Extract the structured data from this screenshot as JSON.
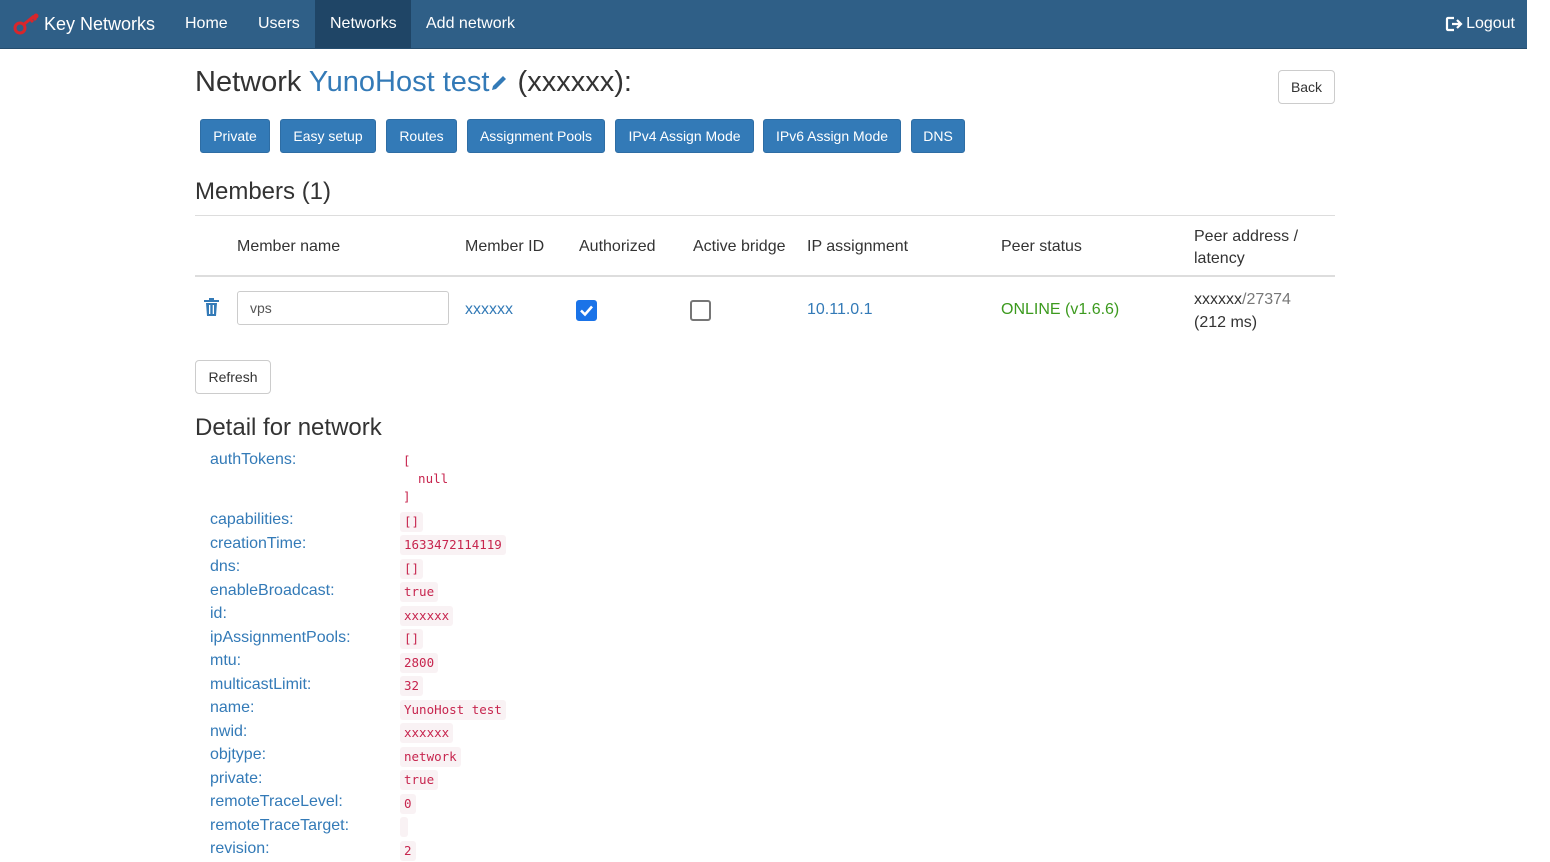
{
  "navbar": {
    "brand": "Key Networks",
    "items": [
      {
        "label": "Home"
      },
      {
        "label": "Users"
      },
      {
        "label": "Networks",
        "active": true
      },
      {
        "label": "Add network"
      }
    ],
    "logout": "Logout"
  },
  "title": {
    "prefix": "Network",
    "name": "YunoHost test",
    "id_suffix": "(xxxxxx):"
  },
  "back_button": "Back",
  "toolbar": [
    "Private",
    "Easy setup",
    "Routes",
    "Assignment Pools",
    "IPv4 Assign Mode",
    "IPv6 Assign Mode",
    "DNS"
  ],
  "members": {
    "heading": "Members (1)",
    "columns": [
      "Member name",
      "Member ID",
      "Authorized",
      "Active bridge",
      "IP assignment",
      "Peer status",
      "Peer address / latency"
    ],
    "rows": [
      {
        "name": "vps",
        "member_id": "xxxxxx",
        "authorized": true,
        "active_bridge": false,
        "ip": "10.11.0.1",
        "peer_status": "ONLINE (v1.6.6)",
        "peer_address": "xxxxxx",
        "peer_port": "/27374",
        "latency": "(212 ms)"
      }
    ]
  },
  "refresh_button": "Refresh",
  "detail": {
    "heading": "Detail for network",
    "entries": [
      {
        "key": "authTokens:",
        "value": "[\n  null\n]"
      },
      {
        "key": "capabilities:",
        "value": "[]"
      },
      {
        "key": "creationTime:",
        "value": "1633472114119"
      },
      {
        "key": "dns:",
        "value": "[]"
      },
      {
        "key": "enableBroadcast:",
        "value": "true"
      },
      {
        "key": "id:",
        "value": "xxxxxx"
      },
      {
        "key": "ipAssignmentPools:",
        "value": "[]"
      },
      {
        "key": "mtu:",
        "value": "2800"
      },
      {
        "key": "multicastLimit:",
        "value": "32"
      },
      {
        "key": "name:",
        "value": "YunoHost test"
      },
      {
        "key": "nwid:",
        "value": "xxxxxx"
      },
      {
        "key": "objtype:",
        "value": "network"
      },
      {
        "key": "private:",
        "value": "true"
      },
      {
        "key": "remoteTraceLevel:",
        "value": "0"
      },
      {
        "key": "remoteTraceTarget:",
        "value": ""
      },
      {
        "key": "revision:",
        "value": "2"
      }
    ]
  },
  "icons": {
    "brand": "key-icon",
    "logout": "logout-icon",
    "edit": "pencil-icon",
    "delete": "trash-icon"
  },
  "colors": {
    "navbar": "#2f5f87",
    "link": "#337ab7",
    "online": "#3c9a1e",
    "code": "#c7254e"
  }
}
